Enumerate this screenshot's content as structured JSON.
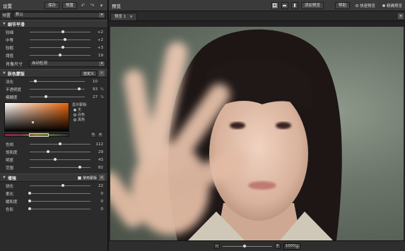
{
  "left_panel": {
    "title": "设置",
    "save_label": "保存",
    "preset_label": "预置",
    "preset_row": {
      "label": "预置",
      "value": "默认"
    },
    "detail_section": {
      "title": "细节平滑",
      "sliders": [
        {
          "label": "较细",
          "value": "+2",
          "fraction": 0.55
        },
        {
          "label": "中等",
          "value": "+2",
          "fraction": 0.58
        },
        {
          "label": "较粗",
          "value": "+3",
          "fraction": 0.55
        },
        {
          "label": "阈值",
          "value": "19",
          "fraction": 0.5
        }
      ],
      "portrait_size": {
        "label": "肖像尺寸",
        "value": "自动检测"
      }
    },
    "skin_section": {
      "title": "肤色蒙版",
      "mode_value": "自定义",
      "sliders": [
        {
          "label": "羽化",
          "value": "10",
          "unit": "",
          "fraction": 0.1
        },
        {
          "label": "不透明度",
          "value": "93",
          "unit": "%",
          "fraction": 0.9
        },
        {
          "label": "模糊度",
          "value": "27",
          "unit": "%",
          "fraction": 0.3
        }
      ],
      "display_label": "显示蒙版:",
      "display_options": [
        "无",
        "白色",
        "黑色"
      ],
      "hsl_sliders": [
        {
          "label": "色相",
          "value": "112",
          "fraction": 0.5
        },
        {
          "label": "饱和度",
          "value": "29",
          "fraction": 0.3
        },
        {
          "label": "明度",
          "value": "43",
          "fraction": 0.42
        },
        {
          "label": "范围",
          "value": "82",
          "fraction": 0.82
        }
      ]
    },
    "enhance_section": {
      "title": "增强",
      "use_mask_label": "使用蒙版",
      "sliders": [
        {
          "label": "锐化",
          "value": "22",
          "fraction": 0.55
        },
        {
          "label": "柔化",
          "value": "0",
          "fraction": 0.0
        },
        {
          "label": "暖和度",
          "value": "0",
          "fraction": 0.0
        },
        {
          "label": "色彩",
          "value": "0",
          "fraction": 0.0
        }
      ]
    }
  },
  "right_panel": {
    "title": "预览",
    "add_preview_label": "添加预览",
    "help_label": "帮助",
    "fast_preview_label": "快速预览",
    "precise_preview_label": "精确预览",
    "tab_label": "预览 1",
    "zoom_value": "100%"
  },
  "colors": {
    "panel": "#2b2b2b",
    "accent": "#e8650a"
  }
}
